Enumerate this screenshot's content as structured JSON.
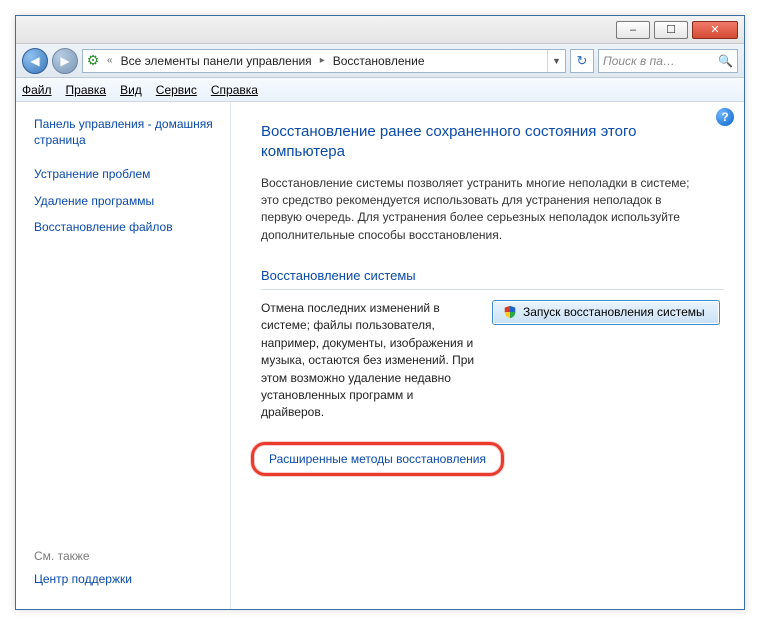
{
  "titlebar": {
    "min": "–",
    "max": "☐",
    "close": "✕"
  },
  "addr": {
    "back_glyph": "◀",
    "fwd_glyph": "▶",
    "chevrons": "«",
    "crumb1": "Все элементы панели управления",
    "crumb2": "Восстановление",
    "sep": "▸",
    "dropdown": "▼",
    "refresh": "↻",
    "search_placeholder": "Поиск в па…",
    "mag": "🔍"
  },
  "menu": {
    "file": "Файл",
    "edit": "Правка",
    "view": "Вид",
    "tools": "Сервис",
    "help": "Справка"
  },
  "sidebar": {
    "home": "Панель управления - домашняя страница",
    "troubleshoot": "Устранение проблем",
    "uninstall": "Удаление программы",
    "restore_files": "Восстановление файлов",
    "see_also_label": "См. также",
    "action_center": "Центр поддержки"
  },
  "content": {
    "heading": "Восстановление ранее сохраненного состояния этого компьютера",
    "description": "Восстановление системы позволяет устранить многие неполадки в системе; это средство рекомендуется использовать для устранения неполадок в первую очередь. Для устранения более серьезных неполадок используйте дополнительные способы восстановления.",
    "section_title": "Восстановление системы",
    "section_text": "Отмена последних изменений в системе; файлы пользователя, например, документы, изображения и музыка, остаются без изменений. При этом возможно удаление недавно установленных программ и драйверов.",
    "start_button": "Запуск восстановления системы",
    "advanced_link": "Расширенные методы восстановления",
    "help_icon": "?"
  }
}
